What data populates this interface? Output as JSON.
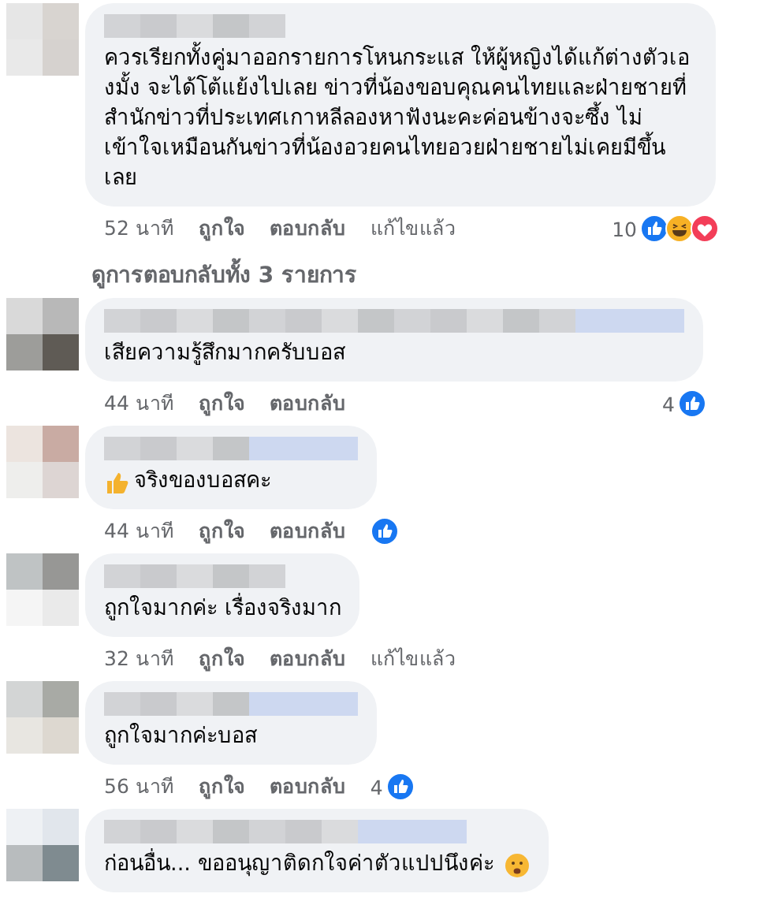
{
  "comment": {
    "text": "ควรเรียกทั้งคู่มาออกรายการโหนกระแส ให้ผู้หญิงได้แก้ต่างตัวเองมั้ง จะได้โต้แย้งไปเลย ข่าวที่น้องขอบคุณคนไทยและฝ่ายชายที่สำนักข่าวที่ประเทศเกาหลีลองหาฟังนะคะค่อนข้างจะซึ้ง ไม่เข้าใจเหมือนกันข่าวที่น้องอวยคนไทยอวยฝ่ายชายไม่เคยมีขึ้นเลย",
    "time": "52 นาที",
    "actions": [
      "ถูกใจ",
      "ตอบกลับ"
    ],
    "edited": "แก้ไขแล้ว",
    "reaction_count": "10",
    "reactions": [
      {
        "kind": "like"
      },
      {
        "kind": "haha"
      },
      {
        "kind": "love"
      }
    ]
  },
  "view_replies": "ดูการตอบกลับทั้ง 3 รายการ",
  "replies": [
    {
      "text": "เสียความรู้สึกมากครับบอส",
      "time": "44 นาที",
      "actions": [
        "ถูกใจ",
        "ตอบกลับ"
      ],
      "reaction_count": "4",
      "reactions": [
        {
          "kind": "like"
        }
      ]
    },
    {
      "text": "จริงของบอสคะ",
      "icon_before": {
        "kind": "thumbs_up"
      },
      "time": "44 นาที",
      "actions": [
        "ถูกใจ",
        "ตอบกลับ"
      ],
      "reactions": [
        {
          "kind": "like"
        }
      ]
    },
    {
      "text": "ถูกใจมากค่ะ เรื่องจริงมาก",
      "time": "32 นาที",
      "actions": [
        "ถูกใจ",
        "ตอบกลับ"
      ],
      "edited": "แก้ไขแล้ว"
    },
    {
      "text": "ถูกใจมากค่ะบอส",
      "time": "56 นาที",
      "actions": [
        "ถูกใจ",
        "ตอบกลับ"
      ],
      "reaction_count": "4",
      "reactions": [
        {
          "kind": "like"
        }
      ]
    },
    {
      "text": "ก่อนอื่น... ขออนุญาติดกใจค่าตัวแปปนึงค่ะ",
      "icon_after": {
        "kind": "worried"
      }
    }
  ]
}
